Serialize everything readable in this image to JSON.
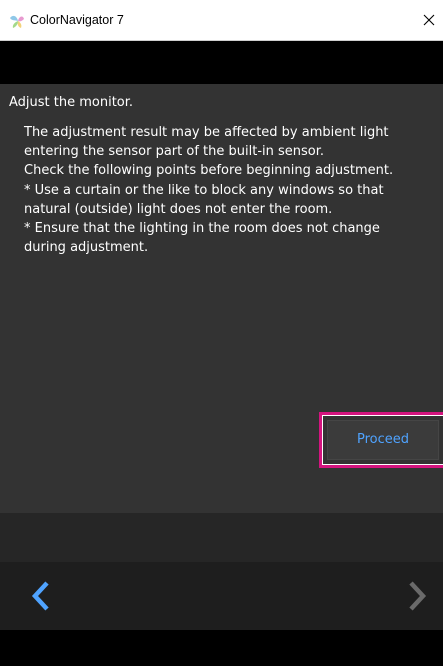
{
  "window": {
    "title": "ColorNavigator 7",
    "app_icon": "colornavigator-logo-icon",
    "close_icon": "close-icon"
  },
  "content": {
    "heading": "Adjust the monitor.",
    "description_lines": [
      "The adjustment result may be affected by ambient light",
      "entering the sensor part of the built-in sensor.",
      "Check the following points before beginning adjustment.",
      "* Use a curtain or the like to block any windows so that",
      "natural (outside) light does not enter the room.",
      "* Ensure that the lighting in the room does not change",
      "during adjustment."
    ]
  },
  "actions": {
    "proceed_label": "Proceed"
  },
  "navigation": {
    "back_icon": "chevron-left-icon",
    "next_icon": "chevron-right-icon",
    "back_enabled": true,
    "next_enabled": false
  },
  "colors": {
    "content_background": "#333333",
    "accent_blue": "#4fa3ff",
    "highlight_frame": "#d4147f",
    "disabled_gray": "#6a6a6a"
  }
}
